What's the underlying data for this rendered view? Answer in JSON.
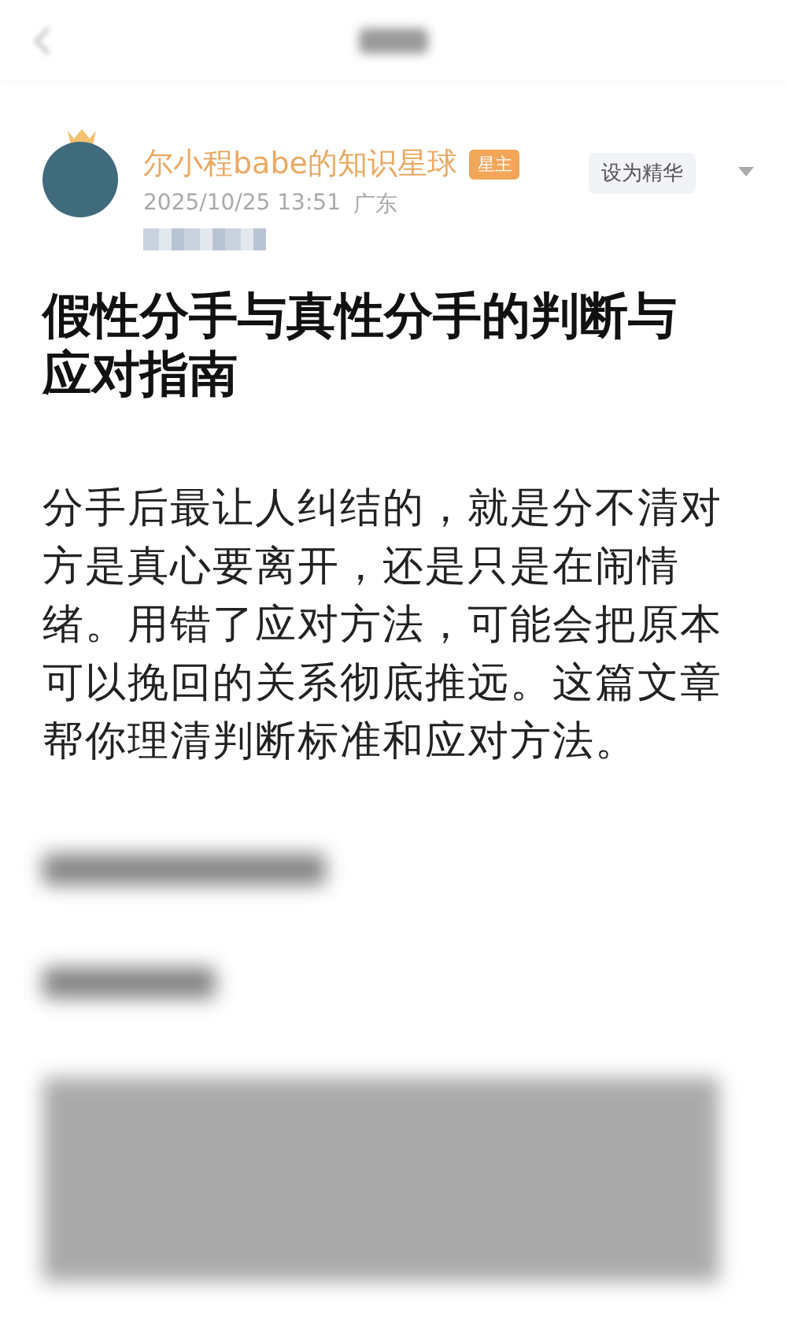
{
  "author": {
    "name": "尔小程babe的知识星球",
    "badge": "星主",
    "time": "2025/10/25 13:51",
    "location": "广东",
    "action": "设为精华"
  },
  "article": {
    "title": "假性分手与真性分手的判断与应对指南",
    "paragraphs": [
      "分手后最让人纠结的，就是分不清对方是真心要离开，还是只是在闹情绪。用错了应对方法，可能会把原本可以挽回的关系彻底推远。这篇文章帮你理清判断标准和应对方法。"
    ]
  }
}
